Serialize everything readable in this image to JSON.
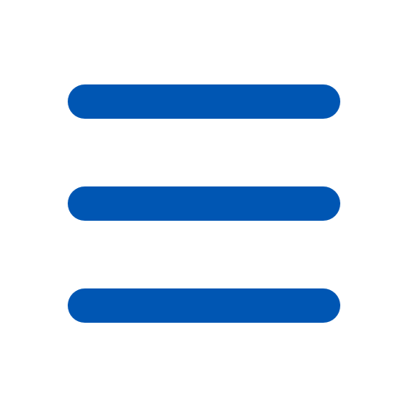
{
  "icon": {
    "name": "hamburger-menu-icon",
    "bar_count": 3,
    "color": "#0056b3",
    "background": "#ffffff"
  }
}
